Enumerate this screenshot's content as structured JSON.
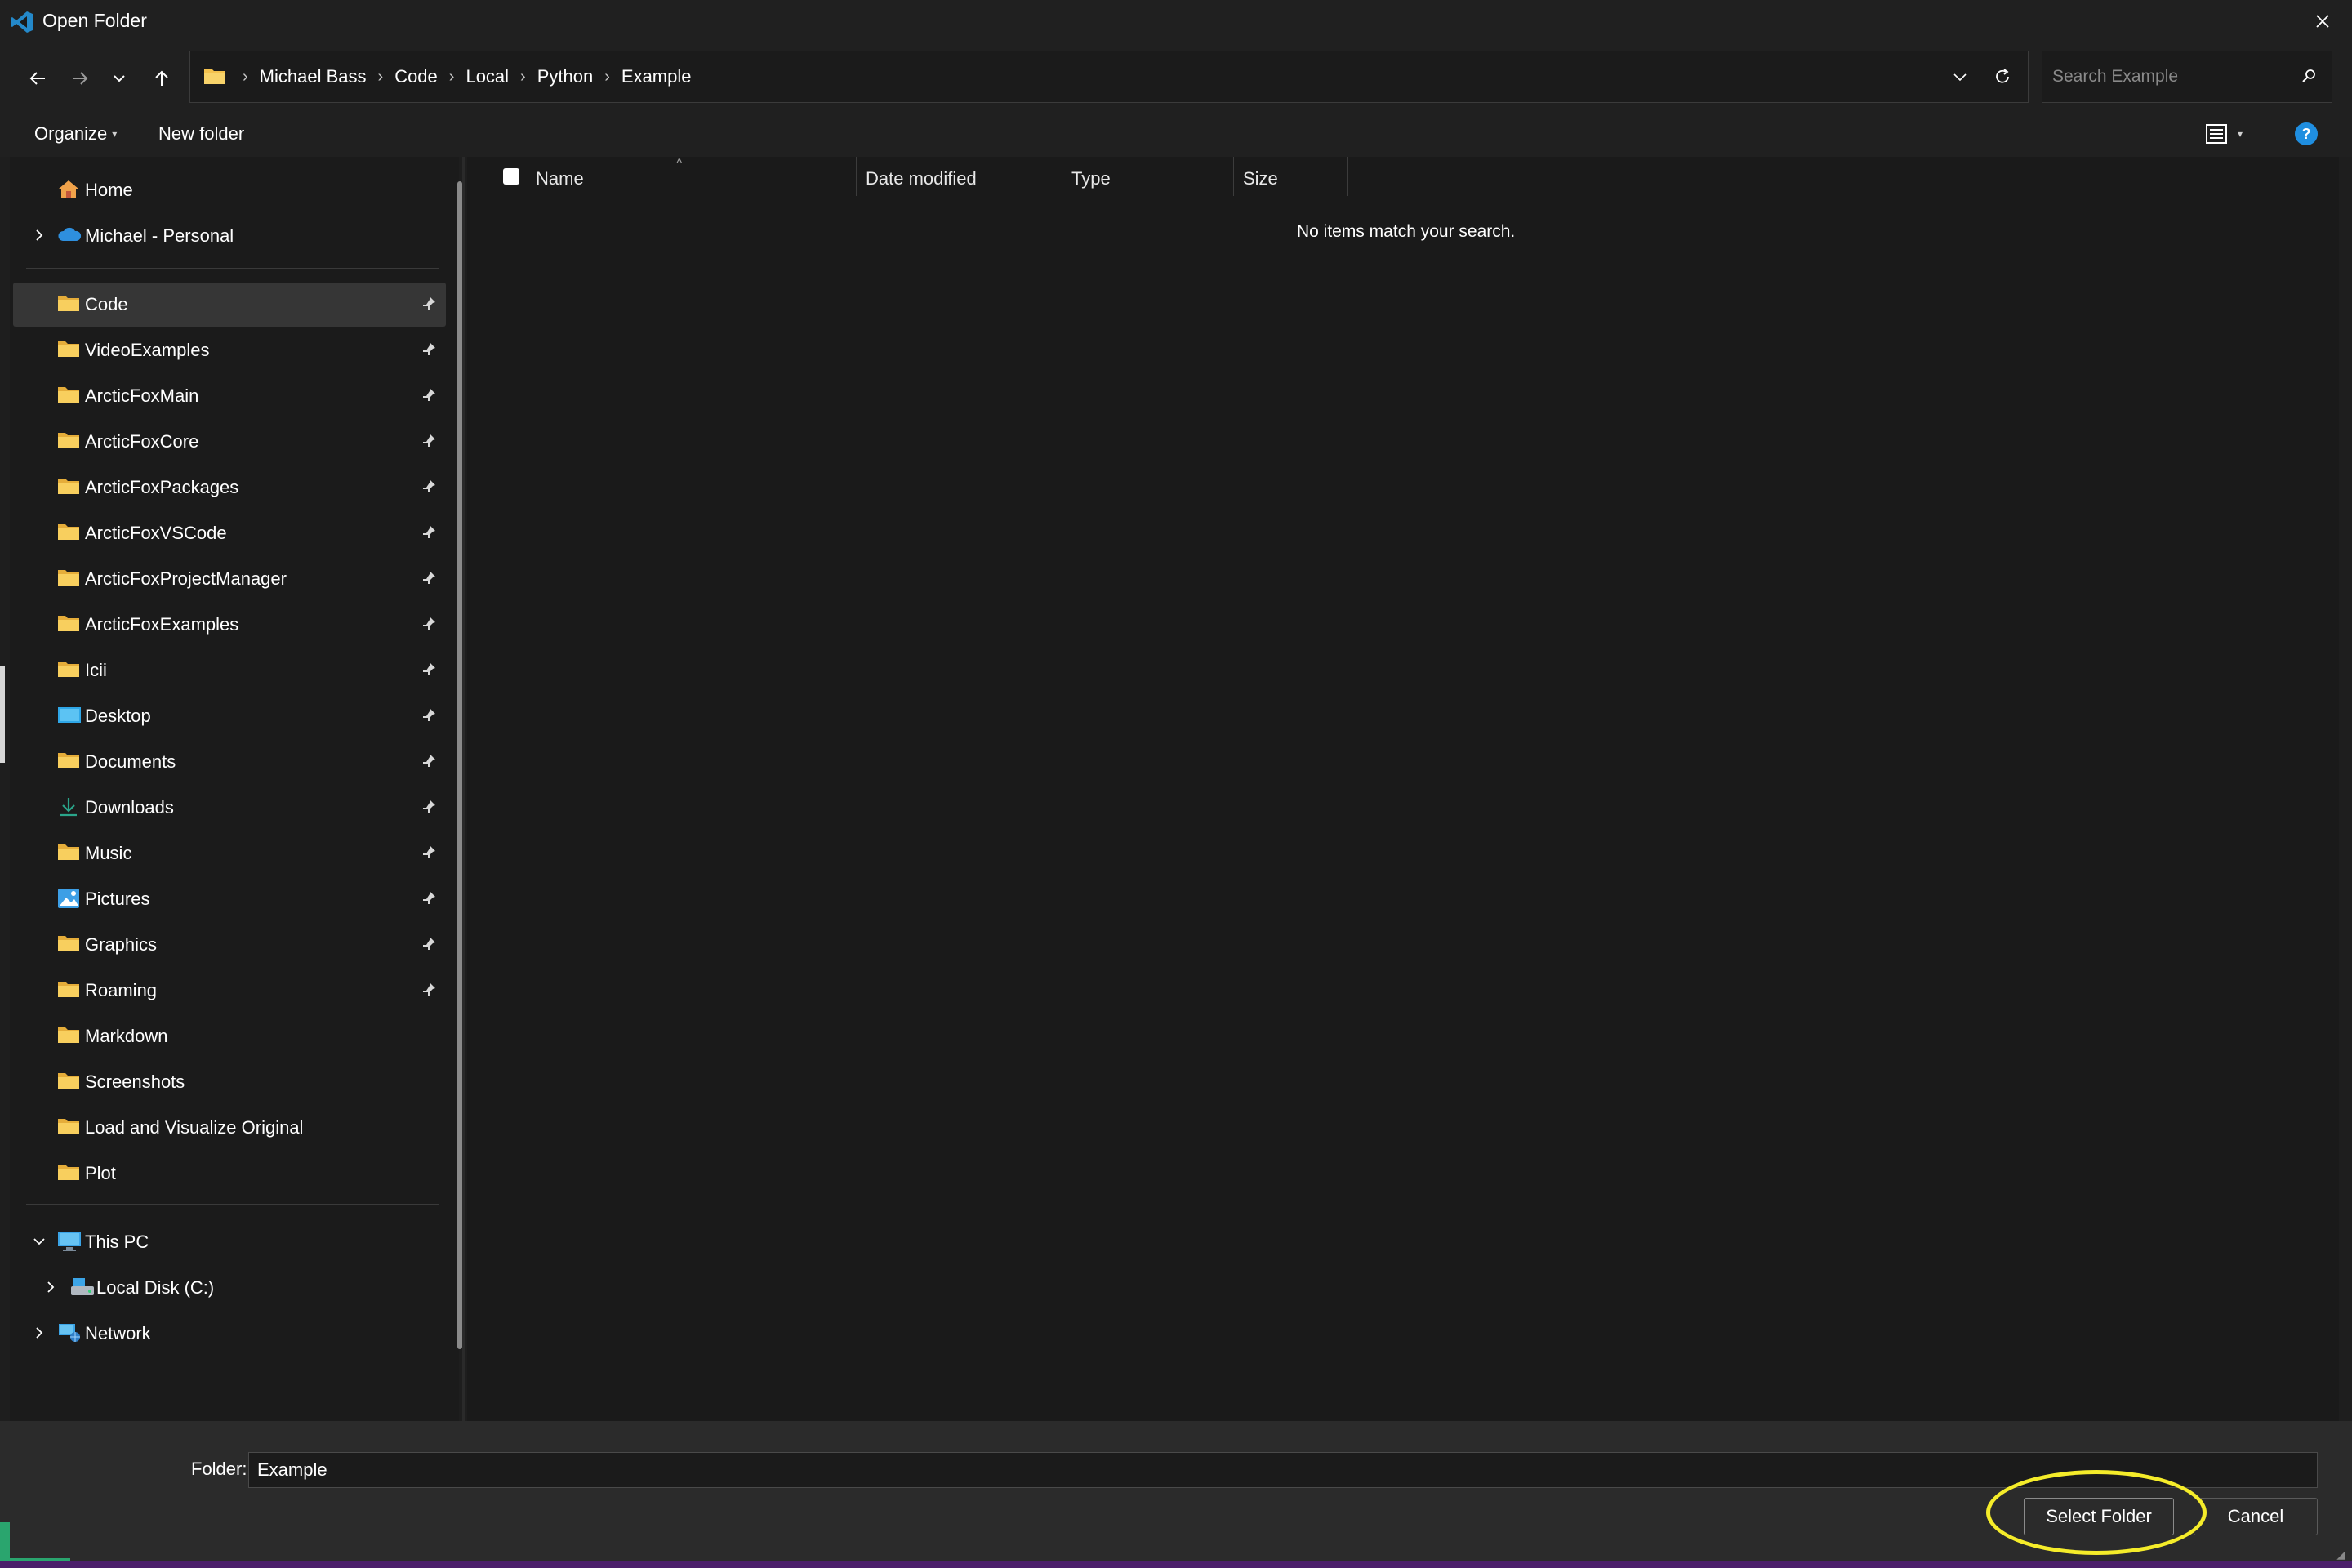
{
  "window": {
    "title": "Open Folder",
    "app_icon": "vscode-icon",
    "close_icon": "close-icon"
  },
  "navigation": {
    "back_icon": "arrow-left-icon",
    "forward_icon": "arrow-right-icon",
    "recent_icon": "chevron-down-icon",
    "up_icon": "arrow-up-icon",
    "breadcrumb": [
      "Michael Bass",
      "Code",
      "Local",
      "Python",
      "Example"
    ],
    "refresh_icon": "refresh-icon",
    "search": {
      "placeholder": "Search Example",
      "value": ""
    }
  },
  "commands": {
    "organize_label": "Organize",
    "new_folder_label": "New folder",
    "view_icon": "details-view-icon",
    "help_icon": "help-icon",
    "help_glyph": "?"
  },
  "sidebar": {
    "top": [
      {
        "label": "Home",
        "icon": "home-icon",
        "expandable": false
      },
      {
        "label": "Michael - Personal",
        "icon": "onedrive-cloud-icon",
        "expandable": true
      }
    ],
    "quick_access": [
      {
        "label": "Code",
        "icon": "folder-icon",
        "pinned": true,
        "selected": true
      },
      {
        "label": "VideoExamples",
        "icon": "folder-icon",
        "pinned": true
      },
      {
        "label": "ArcticFoxMain",
        "icon": "folder-icon",
        "pinned": true
      },
      {
        "label": "ArcticFoxCore",
        "icon": "folder-icon",
        "pinned": true
      },
      {
        "label": "ArcticFoxPackages",
        "icon": "folder-icon",
        "pinned": true
      },
      {
        "label": "ArcticFoxVSCode",
        "icon": "folder-icon",
        "pinned": true
      },
      {
        "label": "ArcticFoxProjectManager",
        "icon": "folder-icon",
        "pinned": true
      },
      {
        "label": "ArcticFoxExamples",
        "icon": "folder-icon",
        "pinned": true
      },
      {
        "label": "Icii",
        "icon": "folder-icon",
        "pinned": true
      },
      {
        "label": "Desktop",
        "icon": "desktop-icon",
        "pinned": true
      },
      {
        "label": "Documents",
        "icon": "folder-icon",
        "pinned": true
      },
      {
        "label": "Downloads",
        "icon": "download-icon",
        "pinned": true
      },
      {
        "label": "Music",
        "icon": "folder-icon",
        "pinned": true
      },
      {
        "label": "Pictures",
        "icon": "pictures-icon",
        "pinned": true
      },
      {
        "label": "Graphics",
        "icon": "folder-icon",
        "pinned": true
      },
      {
        "label": "Roaming",
        "icon": "folder-icon",
        "pinned": true
      },
      {
        "label": "Markdown",
        "icon": "folder-icon",
        "pinned": false
      },
      {
        "label": "Screenshots",
        "icon": "folder-icon",
        "pinned": false
      },
      {
        "label": "Load and Visualize Original",
        "icon": "folder-icon",
        "pinned": false
      },
      {
        "label": "Plot",
        "icon": "folder-icon",
        "pinned": false
      }
    ],
    "devices": [
      {
        "label": "This PC",
        "icon": "computer-icon",
        "expanded": true
      },
      {
        "label": "Local Disk (C:)",
        "icon": "disk-icon",
        "expanded": false
      },
      {
        "label": "Network",
        "icon": "network-icon",
        "expanded": false
      }
    ]
  },
  "file_list": {
    "columns": [
      "Name",
      "Date modified",
      "Type",
      "Size"
    ],
    "empty_message": "No items match your search."
  },
  "footer": {
    "folder_label": "Folder:",
    "folder_value": "Example",
    "select_button": "Select Folder",
    "cancel_button": "Cancel"
  },
  "colors": {
    "folder": "#f4c24e",
    "accent_blue": "#1f8ee0",
    "highlight": "#f5ec2a"
  }
}
